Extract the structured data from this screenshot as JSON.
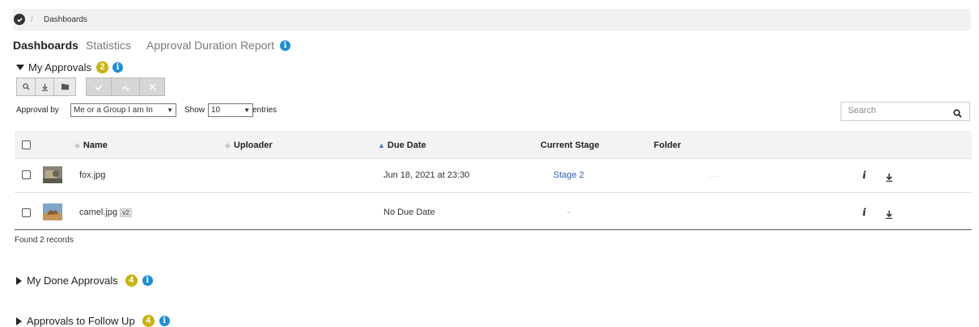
{
  "breadcrumb": {
    "separator": "/",
    "current": "Dashboards"
  },
  "tabs": [
    {
      "label": "Dashboards",
      "active": true
    },
    {
      "label": "Statistics",
      "active": false
    },
    {
      "label": "Approval Duration Report",
      "active": false
    }
  ],
  "my_approvals": {
    "title": "My Approvals",
    "count": "2",
    "toolbar": {
      "group1": [
        "search-icon",
        "download-icon",
        "folder-icon"
      ],
      "group2": [
        "check-icon",
        "partial-check-icon",
        "reject-icon"
      ]
    },
    "filter": {
      "approval_by_label": "Approval by",
      "approval_by_value": "Me or a Group I am In",
      "show_label": "Show",
      "show_value": "10",
      "entries_label": "entries"
    },
    "search_placeholder": "Search",
    "columns": [
      "Name",
      "Uploader",
      "Due Date",
      "Current Stage",
      "Folder"
    ],
    "rows": [
      {
        "name": "fox.jpg",
        "version": "",
        "uploader": "",
        "due_date": "Jun 18, 2021 at 23:30",
        "stage": "Stage 2",
        "folder": ". . ."
      },
      {
        "name": "camel.jpg",
        "version": "v2",
        "uploader": "",
        "due_date": "No Due Date",
        "stage": "-",
        "folder": ""
      }
    ],
    "row_actions": {
      "info": "i"
    },
    "found_text": "Found 2 records"
  },
  "done_approvals": {
    "title": "My Done Approvals",
    "count": "4"
  },
  "follow_up": {
    "title": "Approvals to Follow Up",
    "count": "4"
  },
  "colors": {
    "badge": "#c7b20f",
    "info": "#1e8fd5",
    "link": "#2f5fb3"
  }
}
